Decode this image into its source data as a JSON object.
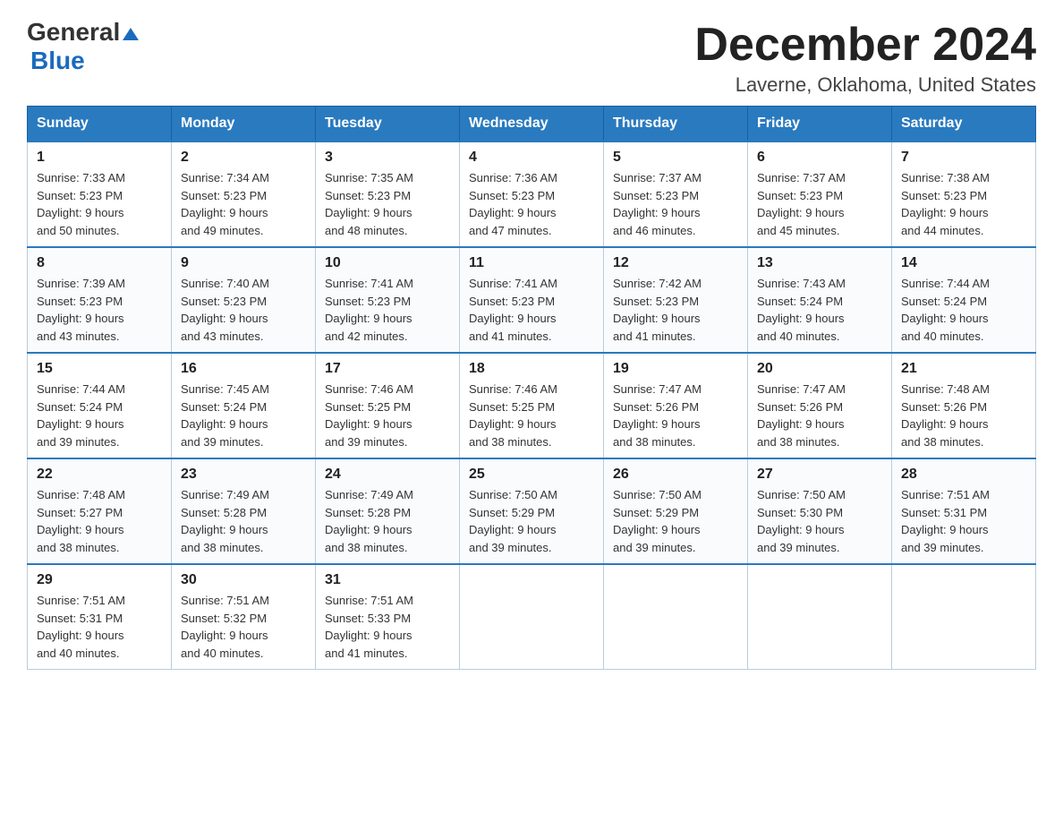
{
  "header": {
    "logo_general": "General",
    "logo_blue": "Blue",
    "title": "December 2024",
    "subtitle": "Laverne, Oklahoma, United States"
  },
  "days_of_week": [
    "Sunday",
    "Monday",
    "Tuesday",
    "Wednesday",
    "Thursday",
    "Friday",
    "Saturday"
  ],
  "weeks": [
    [
      {
        "day": "1",
        "sunrise": "7:33 AM",
        "sunset": "5:23 PM",
        "daylight": "9 hours and 50 minutes."
      },
      {
        "day": "2",
        "sunrise": "7:34 AM",
        "sunset": "5:23 PM",
        "daylight": "9 hours and 49 minutes."
      },
      {
        "day": "3",
        "sunrise": "7:35 AM",
        "sunset": "5:23 PM",
        "daylight": "9 hours and 48 minutes."
      },
      {
        "day": "4",
        "sunrise": "7:36 AM",
        "sunset": "5:23 PM",
        "daylight": "9 hours and 47 minutes."
      },
      {
        "day": "5",
        "sunrise": "7:37 AM",
        "sunset": "5:23 PM",
        "daylight": "9 hours and 46 minutes."
      },
      {
        "day": "6",
        "sunrise": "7:37 AM",
        "sunset": "5:23 PM",
        "daylight": "9 hours and 45 minutes."
      },
      {
        "day": "7",
        "sunrise": "7:38 AM",
        "sunset": "5:23 PM",
        "daylight": "9 hours and 44 minutes."
      }
    ],
    [
      {
        "day": "8",
        "sunrise": "7:39 AM",
        "sunset": "5:23 PM",
        "daylight": "9 hours and 43 minutes."
      },
      {
        "day": "9",
        "sunrise": "7:40 AM",
        "sunset": "5:23 PM",
        "daylight": "9 hours and 43 minutes."
      },
      {
        "day": "10",
        "sunrise": "7:41 AM",
        "sunset": "5:23 PM",
        "daylight": "9 hours and 42 minutes."
      },
      {
        "day": "11",
        "sunrise": "7:41 AM",
        "sunset": "5:23 PM",
        "daylight": "9 hours and 41 minutes."
      },
      {
        "day": "12",
        "sunrise": "7:42 AM",
        "sunset": "5:23 PM",
        "daylight": "9 hours and 41 minutes."
      },
      {
        "day": "13",
        "sunrise": "7:43 AM",
        "sunset": "5:24 PM",
        "daylight": "9 hours and 40 minutes."
      },
      {
        "day": "14",
        "sunrise": "7:44 AM",
        "sunset": "5:24 PM",
        "daylight": "9 hours and 40 minutes."
      }
    ],
    [
      {
        "day": "15",
        "sunrise": "7:44 AM",
        "sunset": "5:24 PM",
        "daylight": "9 hours and 39 minutes."
      },
      {
        "day": "16",
        "sunrise": "7:45 AM",
        "sunset": "5:24 PM",
        "daylight": "9 hours and 39 minutes."
      },
      {
        "day": "17",
        "sunrise": "7:46 AM",
        "sunset": "5:25 PM",
        "daylight": "9 hours and 39 minutes."
      },
      {
        "day": "18",
        "sunrise": "7:46 AM",
        "sunset": "5:25 PM",
        "daylight": "9 hours and 38 minutes."
      },
      {
        "day": "19",
        "sunrise": "7:47 AM",
        "sunset": "5:26 PM",
        "daylight": "9 hours and 38 minutes."
      },
      {
        "day": "20",
        "sunrise": "7:47 AM",
        "sunset": "5:26 PM",
        "daylight": "9 hours and 38 minutes."
      },
      {
        "day": "21",
        "sunrise": "7:48 AM",
        "sunset": "5:26 PM",
        "daylight": "9 hours and 38 minutes."
      }
    ],
    [
      {
        "day": "22",
        "sunrise": "7:48 AM",
        "sunset": "5:27 PM",
        "daylight": "9 hours and 38 minutes."
      },
      {
        "day": "23",
        "sunrise": "7:49 AM",
        "sunset": "5:28 PM",
        "daylight": "9 hours and 38 minutes."
      },
      {
        "day": "24",
        "sunrise": "7:49 AM",
        "sunset": "5:28 PM",
        "daylight": "9 hours and 38 minutes."
      },
      {
        "day": "25",
        "sunrise": "7:50 AM",
        "sunset": "5:29 PM",
        "daylight": "9 hours and 39 minutes."
      },
      {
        "day": "26",
        "sunrise": "7:50 AM",
        "sunset": "5:29 PM",
        "daylight": "9 hours and 39 minutes."
      },
      {
        "day": "27",
        "sunrise": "7:50 AM",
        "sunset": "5:30 PM",
        "daylight": "9 hours and 39 minutes."
      },
      {
        "day": "28",
        "sunrise": "7:51 AM",
        "sunset": "5:31 PM",
        "daylight": "9 hours and 39 minutes."
      }
    ],
    [
      {
        "day": "29",
        "sunrise": "7:51 AM",
        "sunset": "5:31 PM",
        "daylight": "9 hours and 40 minutes."
      },
      {
        "day": "30",
        "sunrise": "7:51 AM",
        "sunset": "5:32 PM",
        "daylight": "9 hours and 40 minutes."
      },
      {
        "day": "31",
        "sunrise": "7:51 AM",
        "sunset": "5:33 PM",
        "daylight": "9 hours and 41 minutes."
      },
      null,
      null,
      null,
      null
    ]
  ],
  "labels": {
    "sunrise": "Sunrise:",
    "sunset": "Sunset:",
    "daylight": "Daylight:"
  }
}
